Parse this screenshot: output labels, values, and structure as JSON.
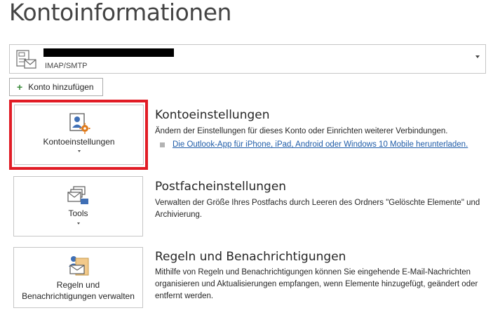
{
  "page": {
    "title": "Kontoinformationen"
  },
  "account_selector": {
    "account_type": "IMAP/SMTP",
    "icon": "mail-account-icon"
  },
  "add_account": {
    "label": "Konto hinzufügen",
    "icon": "plus-icon"
  },
  "sections": [
    {
      "button_label": "Kontoeinstellungen",
      "icon": "account-settings-icon",
      "title": "Kontoeinstellungen",
      "description": "Ändern der Einstellungen für dieses Konto oder Einrichten weiterer Verbindungen.",
      "link": "Die Outlook-App für iPhone, iPad, Android oder Windows 10 Mobile herunterladen."
    },
    {
      "button_label": "Tools",
      "icon": "tools-icon",
      "title": "Postfacheinstellungen",
      "description": "Verwalten der Größe Ihres Postfachs durch Leeren des Ordners \"Gelöschte Elemente\" und Archivierung."
    },
    {
      "button_label_line1": "Regeln und",
      "button_label_line2": "Benachrichtigungen verwalten",
      "icon": "rules-alerts-icon",
      "title": "Regeln und Benachrichtigungen",
      "description": "Mithilfe von Regeln und Benachrichtigungen können Sie eingehende E-Mail-Nachrichten organisieren und Aktualisierungen empfangen, wenn Elemente hinzugefügt, geändert oder entfernt werden."
    }
  ],
  "colors": {
    "highlight": "#e11c25",
    "link": "#1f5ca8",
    "accent_orange": "#e07b1c"
  }
}
